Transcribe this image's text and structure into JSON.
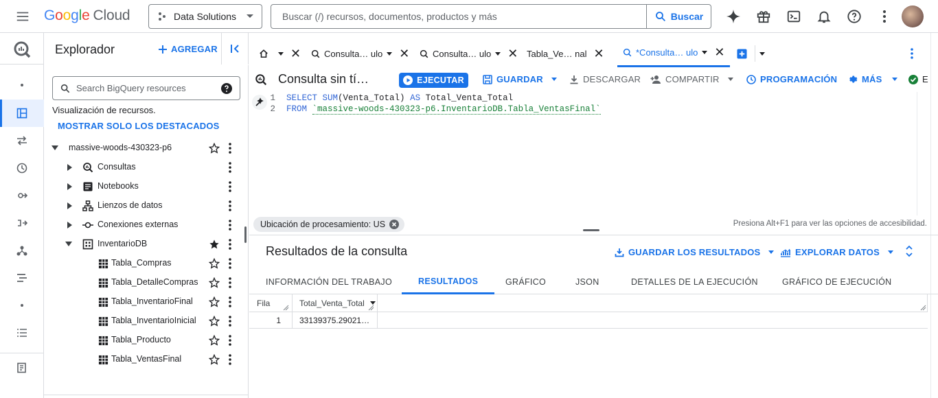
{
  "topbar": {
    "logo": {
      "G": "G",
      "o1": "o",
      "o2": "o",
      "g": "g",
      "l": "l",
      "e": "e",
      "cloud": "Cloud"
    },
    "project": "Data Solutions",
    "search_placeholder": "Buscar (/) recursos, documentos, productos y más",
    "search_button": "Buscar"
  },
  "explorer": {
    "title": "Explorador",
    "add_label": "AGREGAR",
    "search_placeholder": "Search BigQuery resources",
    "visualization_label": "Visualización de recursos.",
    "featured_label": "MOSTRAR SOLO LOS DESTACADOS",
    "project_name": "massive-woods-430323-p6",
    "items": [
      {
        "label": "Consultas",
        "icon": "query-icon"
      },
      {
        "label": "Notebooks",
        "icon": "notebook-icon"
      },
      {
        "label": "Lienzos de datos",
        "icon": "canvas-icon"
      },
      {
        "label": "Conexiones externas",
        "icon": "connection-icon"
      },
      {
        "label": "InventarioDB",
        "icon": "dataset-icon"
      }
    ],
    "tables": [
      "Tabla_Compras",
      "Tabla_DetalleCompras",
      "Tabla_InventarioFinal",
      "Tabla_InventarioInicial",
      "Tabla_Producto",
      "Tabla_VentasFinal"
    ]
  },
  "tabs": [
    {
      "label": "Consulta… ulo"
    },
    {
      "label": "Consulta… ulo"
    },
    {
      "label": "Tabla_Ve… nal"
    },
    {
      "label": "*Consulta… ulo"
    }
  ],
  "query": {
    "title": "Consulta sin tí…",
    "run": "EJECUTAR",
    "save": "GUARDAR",
    "download": "DESCARGAR",
    "share": "COMPARTIR",
    "schedule": "PROGRAMACIÓN",
    "more": "MÁS",
    "trailing": "E",
    "line1": {
      "n": "1",
      "kw1": "SELECT",
      "fn": "SUM",
      "rest": "(Venta_Total) ",
      "kw2": "AS",
      "alias": " Total_Venta_Total"
    },
    "line2": {
      "n": "2",
      "kw": "FROM",
      "table": "`massive-woods-430323-p6.InventarioDB.Tabla_VentasFinal`"
    }
  },
  "status": {
    "location": "Ubicación de procesamiento: US",
    "a11y": "Presiona Alt+F1 para ver las opciones de accesibilidad."
  },
  "results": {
    "title": "Resultados de la consulta",
    "save_results": "GUARDAR LOS RESULTADOS",
    "explore": "EXPLORAR DATOS",
    "tabs": [
      "INFORMACIÓN DEL TRABAJO",
      "RESULTADOS",
      "GRÁFICO",
      "JSON",
      "DETALLES DE LA EJECUCIÓN",
      "GRÁFICO DE EJECUCIÓN"
    ],
    "columns": [
      "Fila",
      "Total_Venta_Total"
    ],
    "rows": [
      {
        "fila": "1",
        "value": "33139375.29021…"
      }
    ]
  }
}
